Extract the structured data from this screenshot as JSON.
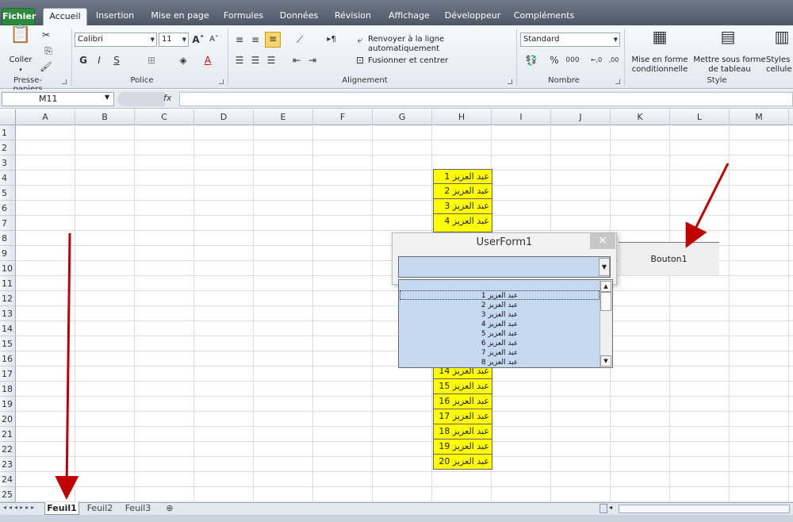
{
  "ribbon": {
    "tabs": [
      "Fichier",
      "Accueil",
      "Insertion",
      "Mise en page",
      "Formules",
      "Données",
      "Révision",
      "Affichage",
      "Développeur",
      "Compléments"
    ],
    "groups": {
      "clipboard": "Presse-papiers",
      "font": "Police",
      "alignment": "Alignement",
      "number": "Nombre",
      "style": "Style"
    },
    "coller": "Coller",
    "font_name": "Calibri",
    "font_size": "11",
    "bold": "G",
    "italic": "I",
    "underline": "S",
    "wrap_text": "Renvoyer à la ligne automatiquement",
    "merge": "Fusionner et centrer",
    "number_format": "Standard",
    "percent": "%",
    "thousands": "000",
    "dec_inc": "←,0",
    "dec_dec": ",00",
    "cond_format_1": "Mise en forme",
    "cond_format_2": "conditionnelle",
    "table_format_1": "Mettre sous forme",
    "table_format_2": "de tableau",
    "styles_1": "Styles",
    "styles_2": "cellule"
  },
  "formula_bar": {
    "name_box": "M11",
    "fx": "fx"
  },
  "columns": [
    "A",
    "B",
    "C",
    "D",
    "E",
    "F",
    "G",
    "H",
    "I",
    "J",
    "K",
    "L",
    "M"
  ],
  "rows": [
    "1",
    "2",
    "3",
    "4",
    "5",
    "6",
    "7",
    "8",
    "9",
    "10",
    "11",
    "12",
    "13",
    "14",
    "15",
    "16",
    "17",
    "18",
    "19",
    "20",
    "21",
    "22",
    "23",
    "24",
    "25"
  ],
  "cells_visible": [
    {
      "label": "عبد العزيز 1"
    },
    {
      "label": "عبد العزيز 2"
    },
    {
      "label": "عبد العزيز 3"
    },
    {
      "label": "عبد العزيز 4"
    },
    {
      "label": "عبد العزيز 14"
    },
    {
      "label": "عبد العزيز 15"
    },
    {
      "label": "عبد العزيز 16"
    },
    {
      "label": "عبد العزيز 17"
    },
    {
      "label": "عبد العزيز 18"
    },
    {
      "label": "عبد العزيز 19"
    },
    {
      "label": "عبد العزيز 20"
    }
  ],
  "userform": {
    "title": "UserForm1",
    "close": "×",
    "list": [
      "عبد العزيز 1",
      "عبد العزيز 2",
      "عبد العزيز 3",
      "عبد العزيز 4",
      "عبد العزيز 5",
      "عبد العزيز 6",
      "عبد العزيز 7",
      "عبد العزيز 8"
    ],
    "button": "Bouton1"
  },
  "sheets": [
    "Feuil1",
    "Feuil2",
    "Feuil3"
  ],
  "colors": {
    "highlight": "#ffff00",
    "listbox": "#c5d9f1",
    "arrow": "#c00000"
  }
}
